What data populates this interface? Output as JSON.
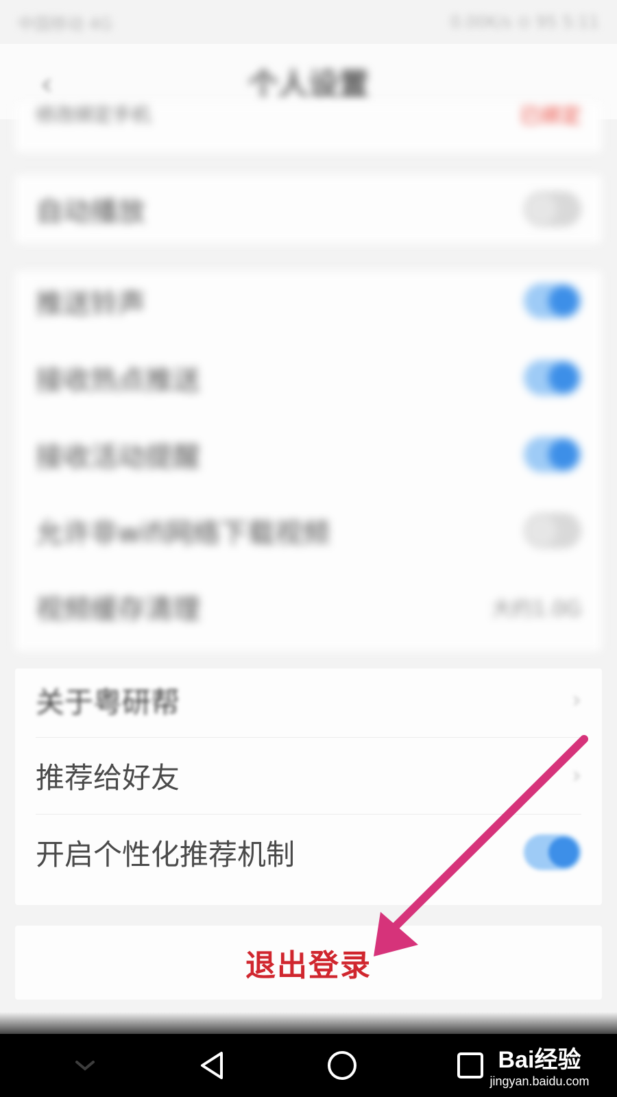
{
  "status_bar": {
    "carrier": "中国移动 4G",
    "right": "0.00K/s  ⊙ 95  5:11"
  },
  "header": {
    "title": "个人设置"
  },
  "top_row": {
    "label": "修改绑定手机",
    "value": "已绑定"
  },
  "section_1": {
    "label": "自动播放",
    "state": "off"
  },
  "section_2": {
    "rows": [
      {
        "label": "推送铃声",
        "state": "on"
      },
      {
        "label": "接收热点推送",
        "state": "on"
      },
      {
        "label": "接收活动提醒",
        "state": "on"
      },
      {
        "label": "允许非wifi网络下载视频",
        "state": "off"
      },
      {
        "label": "视频缓存清理",
        "value": "大约1.0G"
      }
    ]
  },
  "section_3": {
    "rows": [
      {
        "label": "关于粤研帮"
      },
      {
        "label": "推荐给好友"
      },
      {
        "label": "开启个性化推荐机制",
        "state": "on"
      }
    ]
  },
  "logout": {
    "label": "退出登录"
  },
  "arrow": {
    "color": "#d6337a"
  },
  "colors": {
    "accent": "#3d8fe8",
    "logout": "#d0262e",
    "background": "#f3f3f3"
  },
  "nav": {
    "icons": [
      "chevron-down-icon",
      "back-triangle-icon",
      "home-circle-icon",
      "recent-square-icon"
    ]
  },
  "watermark": {
    "logo": "Bai经验",
    "url": "jingyan.baidu.com"
  }
}
